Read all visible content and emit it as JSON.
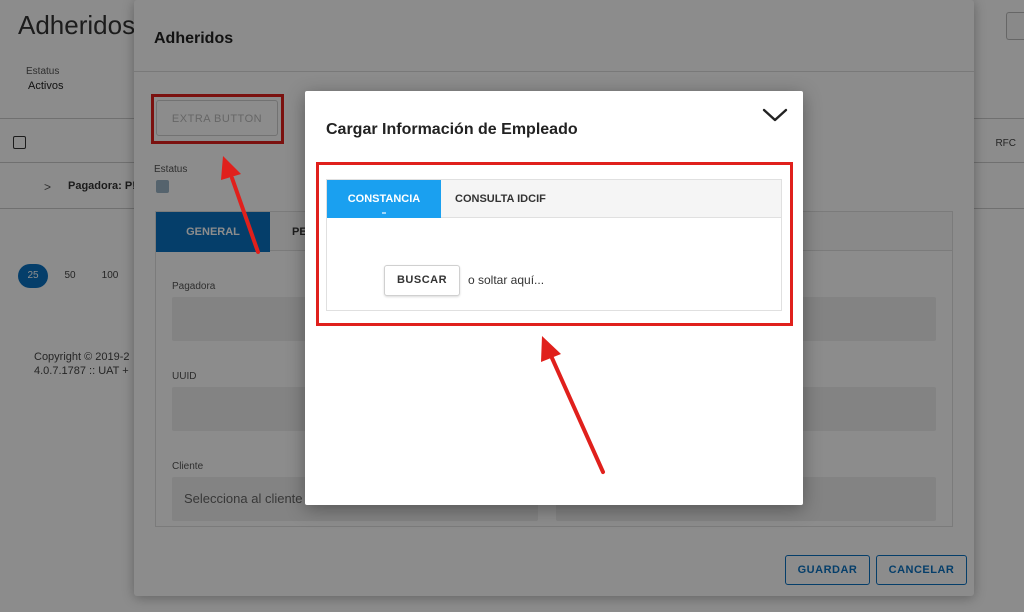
{
  "background": {
    "title": "Adheridos",
    "estatus_label": "Estatus",
    "estatus_value": "Activos",
    "column_rfc": "RFC",
    "pagadora_label": "Pagadora: P!",
    "pagination": [
      "25",
      "50",
      "100"
    ],
    "copyright_line1": "Copyright © 2019-2",
    "copyright_line2": "4.0.7.1787 :: UAT +"
  },
  "mid_dialog": {
    "title": "Adheridos",
    "extra_button": "EXTRA BUTTON",
    "estatus_label": "Estatus",
    "tabs": [
      "GENERAL",
      "PE"
    ],
    "fields": {
      "pagadora": "Pagadora",
      "uuid": "UUID",
      "cliente": "Cliente",
      "cliente_placeholder": "Selecciona al cliente"
    },
    "save_label": "GUARDAR",
    "cancel_label": "CANCELAR"
  },
  "modal": {
    "title": "Cargar Información de Empleado",
    "collapse_icon": "chevron-down-icon",
    "tabs": [
      "CONSTANCIA",
      "CONSULTA IDCIF"
    ],
    "active_tab": "CONSTANCIA",
    "buscar_label": "BUSCAR",
    "drop_hint": "o soltar aquí..."
  },
  "colors": {
    "primary": "#0a72c2",
    "tab_active": "#1aa0f0",
    "annotation_red": "#e0201c"
  }
}
